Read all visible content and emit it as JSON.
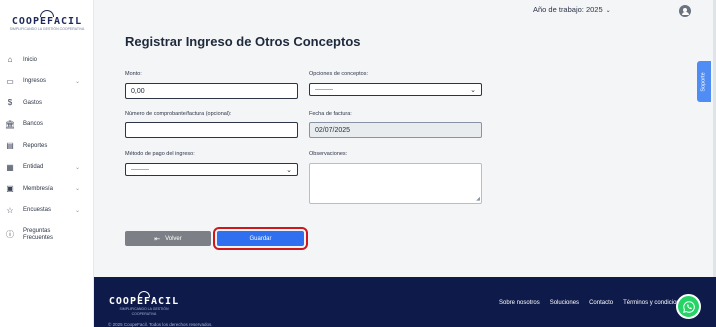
{
  "sidebar": {
    "logo_text": "COOPEFACIL",
    "logo_subtitle": "SIMPLIFICANDO LA GESTIÓN COOPERATIVA",
    "items": [
      {
        "label": "Inicio",
        "icon": "home-icon",
        "has_submenu": false
      },
      {
        "label": "Ingresos",
        "icon": "cash-icon",
        "has_submenu": true
      },
      {
        "label": "Gastos",
        "icon": "dollar-circle-icon",
        "has_submenu": false
      },
      {
        "label": "Bancos",
        "icon": "bank-icon",
        "has_submenu": false
      },
      {
        "label": "Reportes",
        "icon": "report-icon",
        "has_submenu": false
      },
      {
        "label": "Entidad",
        "icon": "building-icon",
        "has_submenu": true
      },
      {
        "label": "Membresía",
        "icon": "calendar-icon",
        "has_submenu": true
      },
      {
        "label": "Encuestas",
        "icon": "star-icon",
        "has_submenu": true
      },
      {
        "label": "Preguntas Frecuentes",
        "icon": "info-icon",
        "has_submenu": false
      }
    ]
  },
  "topbar": {
    "year_label": "Año de trabajo: 2025"
  },
  "support": {
    "label": "Soporte"
  },
  "form": {
    "title": "Registrar Ingreso de Otros Conceptos",
    "monto": {
      "label": "Monto:",
      "value": "0,00"
    },
    "opciones": {
      "label": "Opciones de conceptos:",
      "value": "---------"
    },
    "comprobante": {
      "label": "Número de comprobante/factura (opcional):",
      "value": ""
    },
    "fecha": {
      "label": "Fecha de factura:",
      "value": "02/07/2025"
    },
    "metodo": {
      "label": "Método de pago del ingreso:",
      "value": "---------"
    },
    "observaciones": {
      "label": "Observaciones:",
      "value": ""
    },
    "back_label": "Volver",
    "save_label": "Guardar"
  },
  "footer": {
    "logo_text": "COOPEFACIL",
    "logo_subtitle": "SIMPLIFICANDO LA GESTIÓN COOPERATIVA",
    "links": [
      "Sobre nosotros",
      "Soluciones",
      "Contacto",
      "Términos y condiciones"
    ],
    "copyright": "© 2025 CoopeFacil. Todos los derechos reservados."
  },
  "colors": {
    "primary": "#2f6ff0",
    "footer_bg": "#0e1a4a",
    "highlight": "#d0181c",
    "whatsapp": "#25d366"
  }
}
